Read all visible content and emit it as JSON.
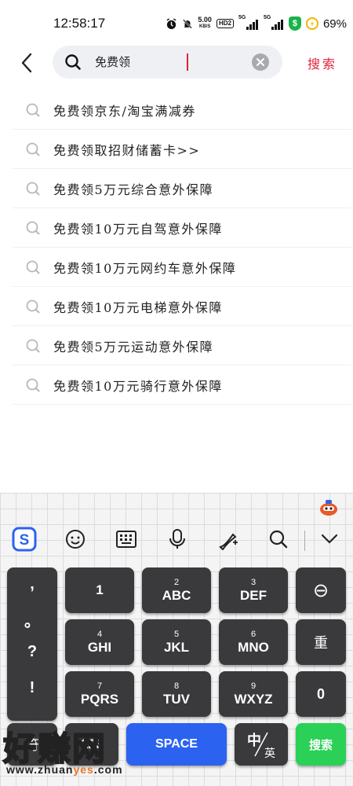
{
  "status_bar": {
    "time": "12:58:17",
    "speed_value": "5.00",
    "speed_unit": "KB/S",
    "hd_badge": "HD2",
    "signal1_label": "5G",
    "signal2_label": "5G",
    "shield_glyph": "$",
    "battery_percent": "69%"
  },
  "header": {
    "search_value": "免费领",
    "search_button_label": "搜索"
  },
  "suggestions": [
    "免费领京东/淘宝满减券",
    "免费领取招财储蓄卡>>",
    "免费领5万元综合意外保障",
    "免费领10万元自驾意外保障",
    "免费领10万元网约车意外保障",
    "免费领10万元电梯意外保障",
    "免费领5万元运动意外保障",
    "免费领10万元骑行意外保障"
  ],
  "keyboard": {
    "punctuation": [
      ",",
      "。",
      "?",
      "!"
    ],
    "keys": {
      "k1": {
        "num": "",
        "letters": "1"
      },
      "k2": {
        "num": "2",
        "letters": "ABC"
      },
      "k3": {
        "num": "3",
        "letters": "DEF"
      },
      "k4": {
        "num": "4",
        "letters": "GHI"
      },
      "k5": {
        "num": "5",
        "letters": "JKL"
      },
      "k6": {
        "num": "6",
        "letters": "MNO"
      },
      "k7": {
        "num": "7",
        "letters": "PQRS"
      },
      "k8": {
        "num": "8",
        "letters": "TUV"
      },
      "k9": {
        "num": "9",
        "letters": "WXYZ"
      }
    },
    "delete_label": "⊖",
    "retype_label": "重",
    "zero_label": "0",
    "symbol_label": "符",
    "space_label": "SPACE",
    "lang_main": "中",
    "lang_sub": "英",
    "search_label": "搜索",
    "toolbar_icons": [
      "sogou-logo-icon",
      "emoji-icon",
      "keyboard-icon",
      "microphone-icon",
      "handwriting-icon",
      "search-icon",
      "collapse-icon"
    ]
  },
  "watermark": {
    "big": "好赚网",
    "small_prefix": "www.zhuan",
    "small_highlight": "yes",
    "small_suffix": ".com"
  },
  "colors": {
    "accent_red": "#e0243a",
    "space_blue": "#2b63f0",
    "search_green": "#2ad156",
    "key_dark": "#3a3a3c"
  }
}
